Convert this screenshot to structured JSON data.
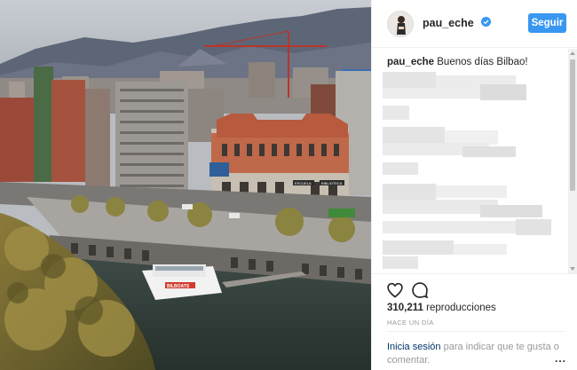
{
  "post": {
    "username": "pau_eche",
    "follow_label": "Seguir",
    "caption_user": "pau_eche",
    "caption_text": "Buenos días Bilbao!",
    "views_count": "310,211",
    "views_label": "reproducciones",
    "timestamp": "HACE UN DÍA",
    "login_link": "Inicia sesión",
    "login_rest": "para indicar que te gusta o comentar.",
    "more_label": "..."
  },
  "photo": {
    "boat_sign": "BILBOATS",
    "building_signs": [
      "ESCUELA",
      "BIBLIOTECA"
    ]
  },
  "colors": {
    "accent": "#3897f0",
    "link": "#003569",
    "muted": "#999999"
  }
}
